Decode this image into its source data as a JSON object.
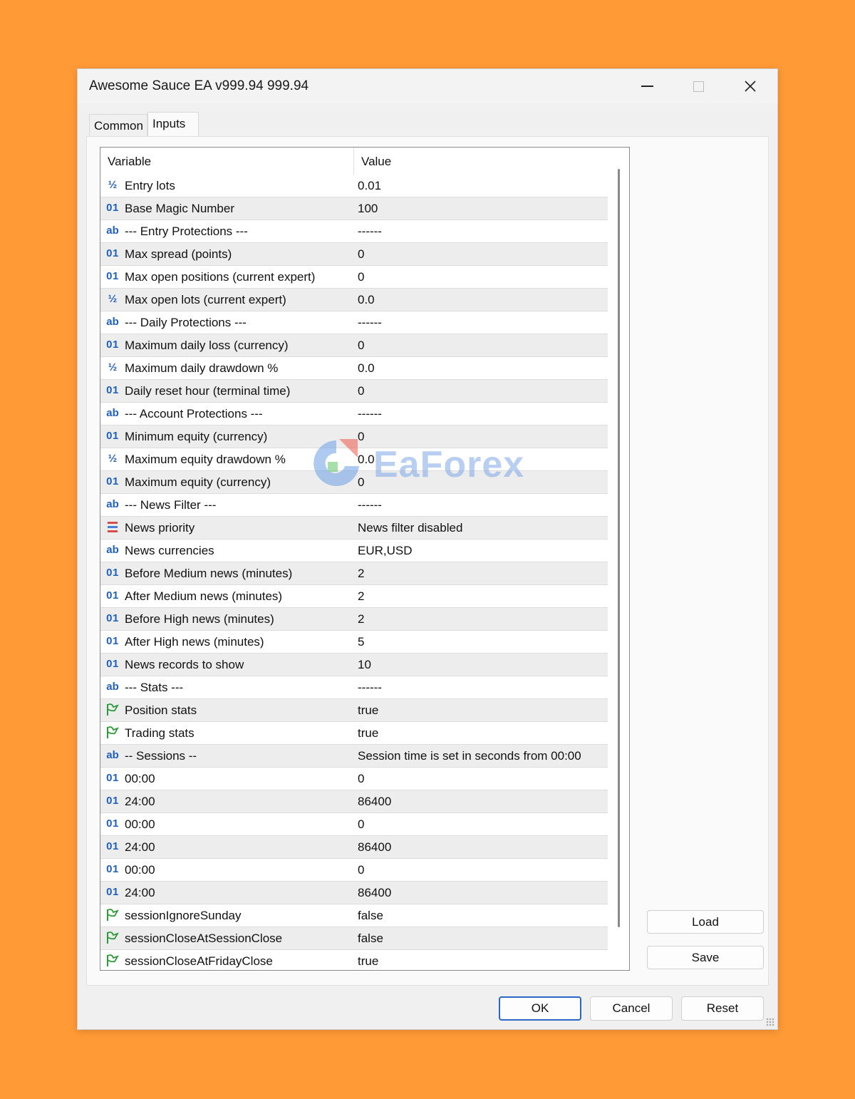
{
  "window": {
    "title": "Awesome Sauce EA v999.94 999.94"
  },
  "tabs": [
    {
      "label": "Common"
    },
    {
      "label": "Inputs"
    }
  ],
  "grid": {
    "headers": {
      "variable": "Variable",
      "value": "Value"
    },
    "rows": [
      {
        "icon": "fraction-icon",
        "glyph": "½",
        "variable": "Entry lots",
        "value": "0.01"
      },
      {
        "icon": "integer-icon",
        "glyph": "01",
        "variable": "Base Magic Number",
        "value": "100"
      },
      {
        "icon": "string-icon",
        "glyph": "ab",
        "variable": "--- Entry Protections ---",
        "value": "------"
      },
      {
        "icon": "integer-icon",
        "glyph": "01",
        "variable": "Max spread (points)",
        "value": "0"
      },
      {
        "icon": "integer-icon",
        "glyph": "01",
        "variable": "Max open positions (current expert)",
        "value": "0"
      },
      {
        "icon": "fraction-icon",
        "glyph": "½",
        "variable": "Max open lots (current expert)",
        "value": "0.0"
      },
      {
        "icon": "string-icon",
        "glyph": "ab",
        "variable": "--- Daily Protections ---",
        "value": "------"
      },
      {
        "icon": "integer-icon",
        "glyph": "01",
        "variable": "Maximum daily loss (currency)",
        "value": "0"
      },
      {
        "icon": "fraction-icon",
        "glyph": "½",
        "variable": "Maximum daily drawdown %",
        "value": "0.0"
      },
      {
        "icon": "integer-icon",
        "glyph": "01",
        "variable": "Daily reset hour (terminal time)",
        "value": "0"
      },
      {
        "icon": "string-icon",
        "glyph": "ab",
        "variable": "--- Account Protections ---",
        "value": "------"
      },
      {
        "icon": "integer-icon",
        "glyph": "01",
        "variable": "Minimum equity (currency)",
        "value": "0"
      },
      {
        "icon": "fraction-icon",
        "glyph": "½",
        "variable": "Maximum equity drawdown %",
        "value": "0.0"
      },
      {
        "icon": "integer-icon",
        "glyph": "01",
        "variable": "Maximum equity (currency)",
        "value": "0"
      },
      {
        "icon": "string-icon",
        "glyph": "ab",
        "variable": "--- News Filter ---",
        "value": "------"
      },
      {
        "icon": "enum-icon",
        "glyph": "",
        "variable": "News priority",
        "value": "News filter disabled"
      },
      {
        "icon": "string-icon",
        "glyph": "ab",
        "variable": "News currencies",
        "value": "EUR,USD"
      },
      {
        "icon": "integer-icon",
        "glyph": "01",
        "variable": "Before Medium news (minutes)",
        "value": "2"
      },
      {
        "icon": "integer-icon",
        "glyph": "01",
        "variable": "After Medium news (minutes)",
        "value": "2"
      },
      {
        "icon": "integer-icon",
        "glyph": "01",
        "variable": "Before High news (minutes)",
        "value": "2"
      },
      {
        "icon": "integer-icon",
        "glyph": "01",
        "variable": "After High news (minutes)",
        "value": "5"
      },
      {
        "icon": "integer-icon",
        "glyph": "01",
        "variable": "News records to show",
        "value": "10"
      },
      {
        "icon": "string-icon",
        "glyph": "ab",
        "variable": "--- Stats ---",
        "value": "------"
      },
      {
        "icon": "bool-icon",
        "glyph": "",
        "variable": "Position stats",
        "value": "true"
      },
      {
        "icon": "bool-icon",
        "glyph": "",
        "variable": "Trading stats",
        "value": "true"
      },
      {
        "icon": "string-icon",
        "glyph": "ab",
        "variable": "-- Sessions --",
        "value": " Session time is set in seconds from 00:00"
      },
      {
        "icon": "integer-icon",
        "glyph": "01",
        "variable": "00:00",
        "value": "0"
      },
      {
        "icon": "integer-icon",
        "glyph": "01",
        "variable": "24:00",
        "value": "86400"
      },
      {
        "icon": "integer-icon",
        "glyph": "01",
        "variable": "00:00",
        "value": "0"
      },
      {
        "icon": "integer-icon",
        "glyph": "01",
        "variable": "24:00",
        "value": "86400"
      },
      {
        "icon": "integer-icon",
        "glyph": "01",
        "variable": "00:00",
        "value": "0"
      },
      {
        "icon": "integer-icon",
        "glyph": "01",
        "variable": "24:00",
        "value": "86400"
      },
      {
        "icon": "bool-icon",
        "glyph": "",
        "variable": "sessionIgnoreSunday",
        "value": "false"
      },
      {
        "icon": "bool-icon",
        "glyph": "",
        "variable": "sessionCloseAtSessionClose",
        "value": "false"
      },
      {
        "icon": "bool-icon",
        "glyph": "",
        "variable": "sessionCloseAtFridayClose",
        "value": "true"
      }
    ]
  },
  "side_buttons": {
    "load": "Load",
    "save": "Save"
  },
  "bottom_buttons": {
    "ok": "OK",
    "cancel": "Cancel",
    "reset": "Reset"
  },
  "watermark": {
    "text": "EaForex"
  },
  "colors": {
    "background": "#FF9A36",
    "accent": "#2a66c8",
    "int_icon": "#1f5fbf",
    "string_icon": "#e2a040",
    "bool_icon": "#2e9a3c"
  }
}
